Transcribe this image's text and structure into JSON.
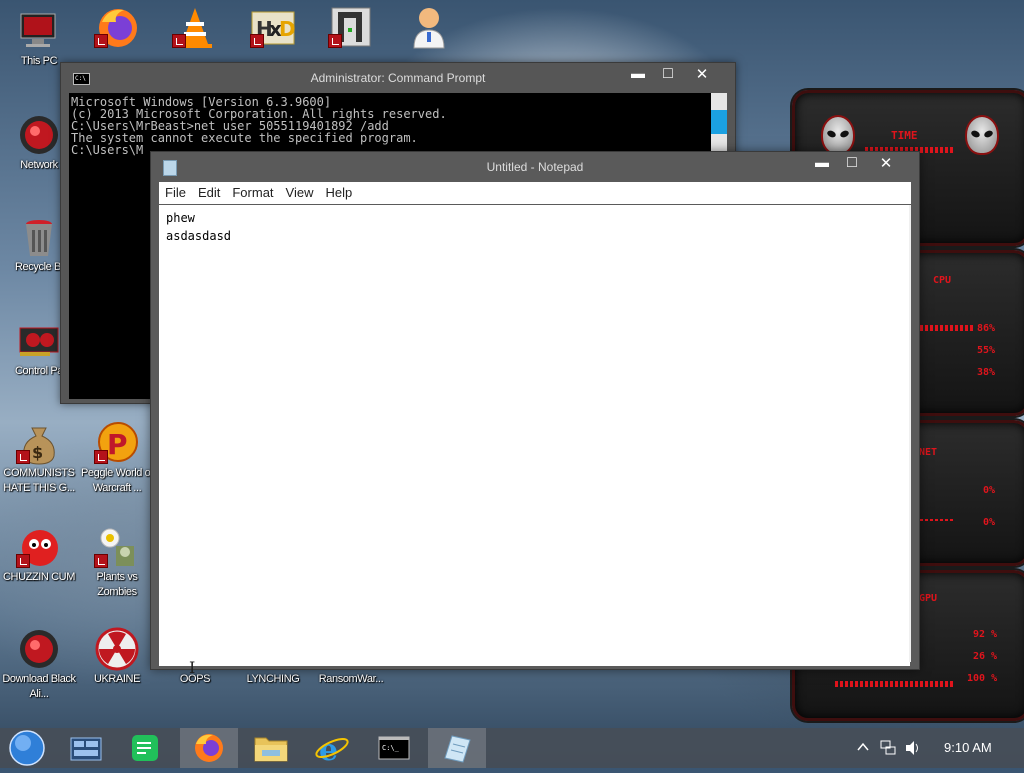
{
  "desktop": {
    "icons": [
      {
        "label": "This PC"
      },
      {
        "label": "Network"
      },
      {
        "label": "Recycle Bi"
      },
      {
        "label": "Control Pa"
      },
      {
        "label": "COMMUNISTS HATE THIS G..."
      },
      {
        "label": "Peggle World of Warcraft ..."
      },
      {
        "label": "CHUZZIN CUM"
      },
      {
        "label": "Plants vs Zombies"
      },
      {
        "label": "Download Black Ali..."
      },
      {
        "label": "UKRAINE"
      },
      {
        "label": "OOPS"
      },
      {
        "label": "LYNCHING"
      },
      {
        "label": "RansomWar..."
      }
    ],
    "top_icons": [
      "firefox-shortcut-icon",
      "vlc-icon",
      "hxd-icon",
      "app-icon",
      "doctor-icon"
    ]
  },
  "cmd_window": {
    "title": "Administrator: Command Prompt",
    "lines": [
      "Microsoft Windows [Version 6.3.9600]",
      "(c) 2013 Microsoft Corporation. All rights reserved.",
      "",
      "C:\\Users\\MrBeast>net user 5055119401892 /add",
      "The system cannot execute the specified program.",
      "",
      "C:\\Users\\M"
    ],
    "sysicon": "C:\\"
  },
  "notepad": {
    "title": "Untitled - Notepad",
    "menu": [
      "File",
      "Edit",
      "Format",
      "View",
      "Help"
    ],
    "text_lines": [
      "phew",
      "asdasdasd"
    ]
  },
  "gadget": {
    "labels": [
      "TIME",
      "CPU",
      "NET",
      "GPU"
    ],
    "values": [
      "86%",
      "55%",
      "38%",
      "0%",
      "0%",
      "92 %",
      "26 %",
      "100 %"
    ]
  },
  "window_controls": {
    "minimize": "▬",
    "maximize": "□",
    "close": "✕"
  },
  "taskbar": {
    "apps": [
      "start-orb",
      "task-view",
      "spotify-like-app",
      "firefox",
      "file-explorer",
      "internet-explorer",
      "command-prompt",
      "notepad"
    ],
    "clock": "9:10 AM"
  },
  "colors": {
    "accent": "#e0141c",
    "taskbar": "#464e58",
    "cmd_thumb": "#1ba1e2"
  }
}
